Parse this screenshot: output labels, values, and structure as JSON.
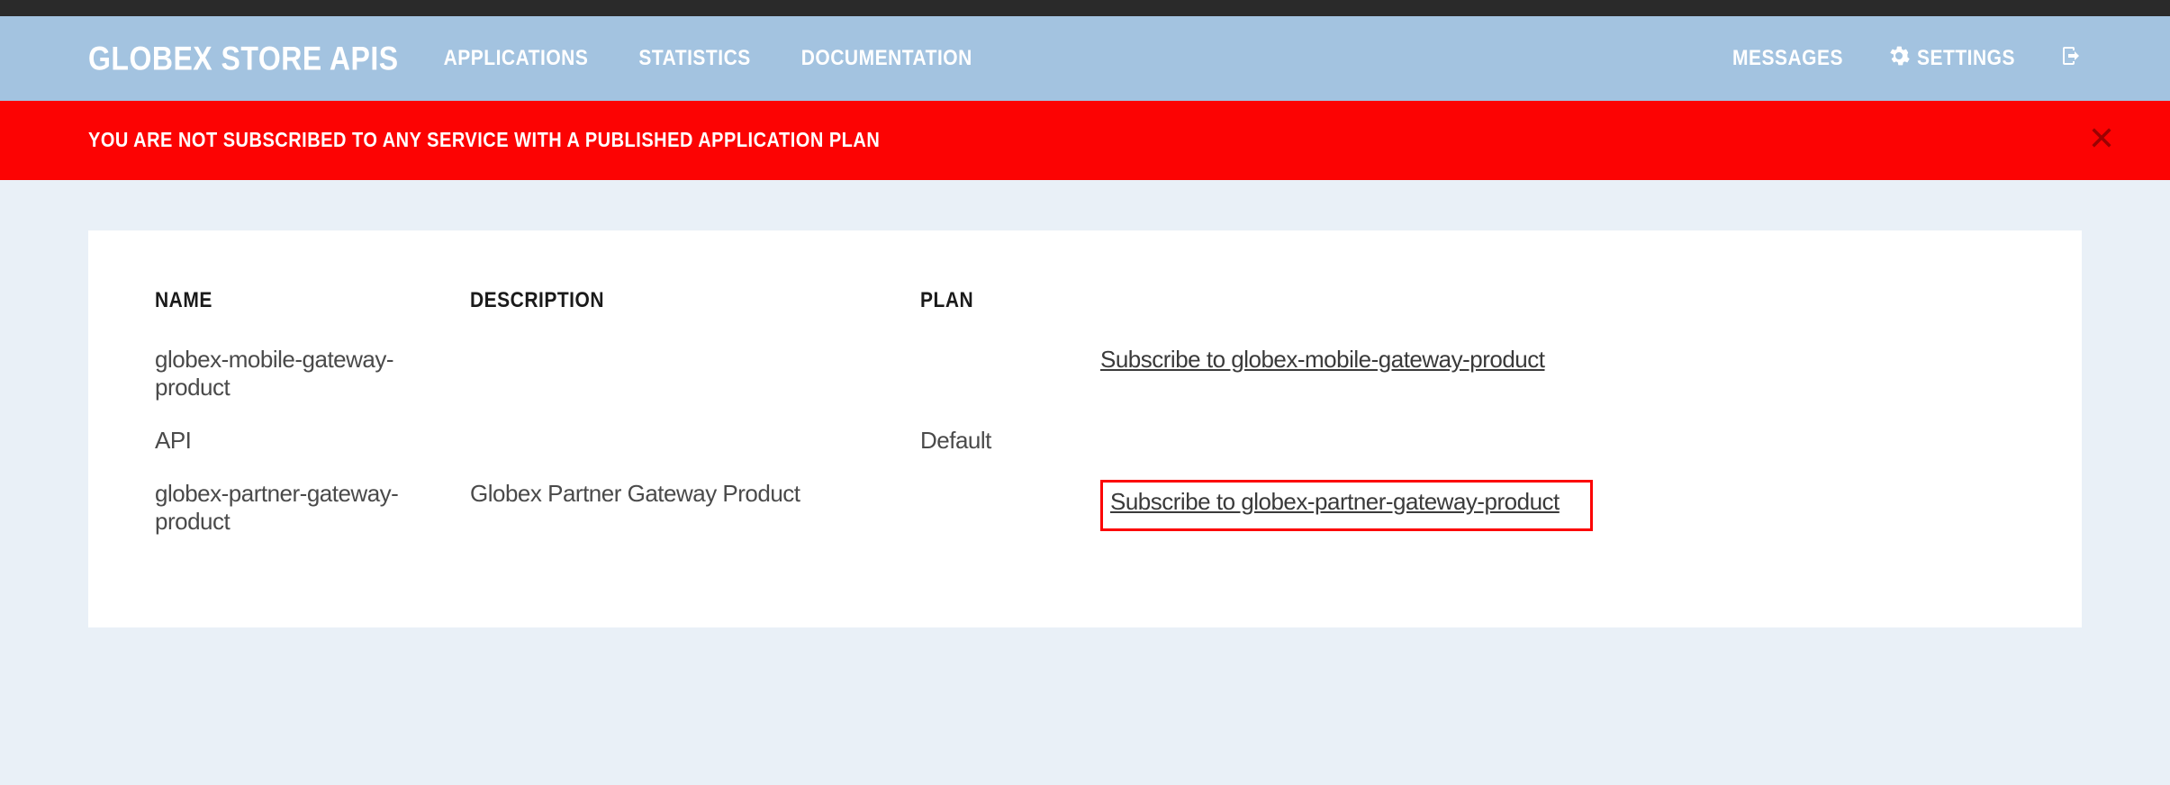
{
  "header": {
    "brand": "GLOBEX STORE APIS",
    "nav": {
      "applications": "APPLICATIONS",
      "statistics": "STATISTICS",
      "documentation": "DOCUMENTATION"
    },
    "right": {
      "messages": "MESSAGES",
      "settings": "SETTINGS"
    }
  },
  "alert": {
    "message": "YOU ARE NOT SUBSCRIBED TO ANY SERVICE WITH A PUBLISHED APPLICATION PLAN"
  },
  "table": {
    "headers": {
      "name": "NAME",
      "description": "DESCRIPTION",
      "plan": "PLAN"
    },
    "rows": [
      {
        "name": "globex-mobile-gateway-product",
        "description": "",
        "plan": "",
        "subscribe": "Subscribe to globex-mobile-gateway-product",
        "highlighted": false
      },
      {
        "name": "API",
        "description": "",
        "plan": "Default",
        "subscribe": "",
        "highlighted": false
      },
      {
        "name": "globex-partner-gateway-product",
        "description": "Globex Partner Gateway Product",
        "plan": "",
        "subscribe": "Subscribe to globex-partner-gateway-product",
        "highlighted": true
      }
    ]
  }
}
